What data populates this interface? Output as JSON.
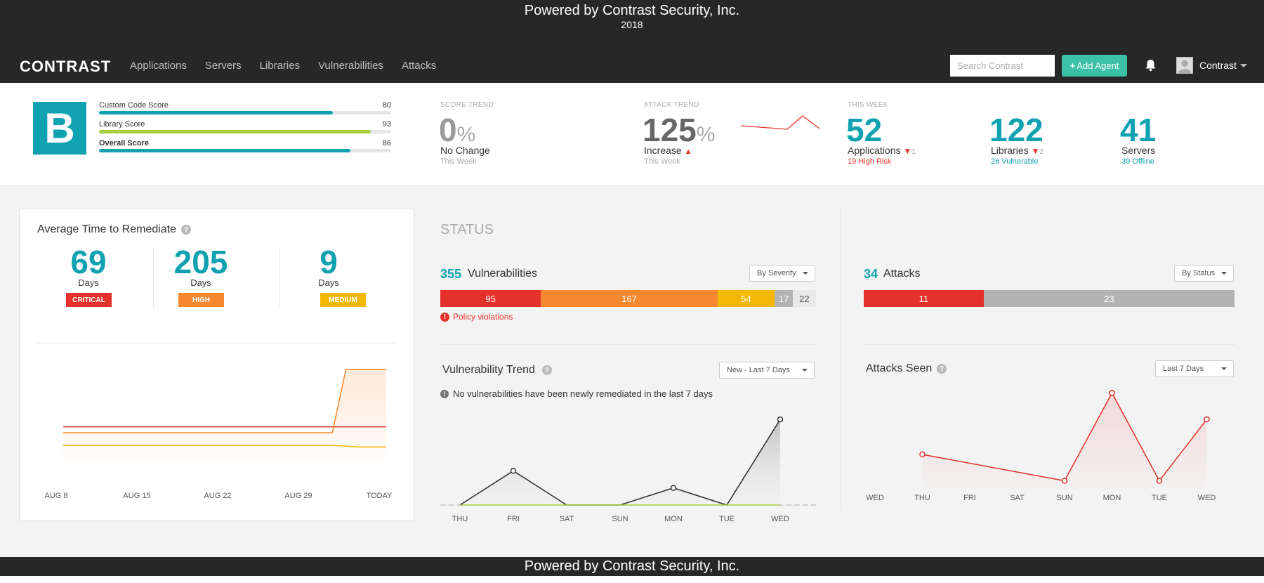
{
  "banner": {
    "title": "Powered by Contrast Security, Inc.",
    "year": "2018"
  },
  "logo": "CONTRAST",
  "nav": [
    "Applications",
    "Servers",
    "Libraries",
    "Vulnerabilities",
    "Attacks"
  ],
  "search": {
    "placeholder": "Search Contrast",
    "value": ""
  },
  "add_agent_label": "Add Agent",
  "user": {
    "name": "Contrast"
  },
  "colors": {
    "teal": "#11a2b1",
    "green": "#3cc0a8",
    "critical": "#e4322b",
    "high": "#f7882f",
    "medium": "#f5b800",
    "lime": "#a5cd3e",
    "grey": "#b3b3b3"
  },
  "scores": {
    "grade": "B",
    "items": [
      {
        "label": "Custom Code Score",
        "value": 80
      },
      {
        "label": "Library Score",
        "value": 93
      },
      {
        "label": "Overall Score",
        "value": 86
      }
    ]
  },
  "score_trend": {
    "caption": "SCORE TREND",
    "value": "0",
    "unit": "%",
    "status": "No Change",
    "period": "This Week"
  },
  "attack_trend": {
    "caption": "ATTACK TREND",
    "value": "125",
    "unit": "%",
    "status": "Increase",
    "period": "This Week"
  },
  "this_week": {
    "caption": "THIS WEEK",
    "applications": {
      "value": "52",
      "label": "Applications",
      "delta": "1",
      "sub": "19 High Risk"
    },
    "libraries": {
      "value": "122",
      "label": "Libraries",
      "delta": "2",
      "sub": "26 Vulnerable"
    },
    "servers": {
      "value": "41",
      "label": "Servers",
      "sub": "39 Offline"
    }
  },
  "remediate": {
    "title": "Average Time to Remediate",
    "items": [
      {
        "value": "69",
        "unit": "Days",
        "severity": "CRITICAL"
      },
      {
        "value": "205",
        "unit": "Days",
        "severity": "HIGH"
      },
      {
        "value": "9",
        "unit": "Days",
        "severity": "MEDIUM"
      }
    ]
  },
  "status": {
    "title": "STATUS",
    "vulnerabilities": {
      "count": "355",
      "label": "Vulnerabilities",
      "dropdown": "By Severity",
      "segments": [
        {
          "value": "95",
          "color": "#e4322b"
        },
        {
          "value": "167",
          "color": "#f7882f"
        },
        {
          "value": "54",
          "color": "#f5b800"
        },
        {
          "value": "17",
          "color": "#b3b3b3"
        },
        {
          "value": "22",
          "color": "#e9e9e9"
        }
      ],
      "policy": "Policy violations"
    },
    "attacks": {
      "count": "34",
      "label": "Attacks",
      "dropdown": "By Status",
      "segments": [
        {
          "value": "11",
          "color": "#e4322b"
        },
        {
          "value": "23",
          "color": "#b3b3b3"
        }
      ]
    }
  },
  "vuln_trend": {
    "title": "Vulnerability Trend",
    "dropdown": "New - Last 7 Days",
    "message": "No vulnerabilities have been newly remediated in the last 7 days"
  },
  "attacks_seen": {
    "title": "Attacks Seen",
    "dropdown": "Last 7 Days"
  },
  "chart_data": [
    {
      "type": "line",
      "title": "Average Time to Remediate",
      "x": [
        "AUG 8",
        "AUG 15",
        "AUG 22",
        "AUG 29",
        "TODAY"
      ],
      "series": [
        {
          "values": [
            0.84,
            0.84,
            0.84,
            0.84,
            0.84,
            0.84,
            0.84,
            0.84,
            0.84,
            0.84,
            0.84,
            0.84,
            0.84,
            0.84,
            0.84,
            0.84,
            0.84,
            0.84,
            0.84,
            0.84,
            0.84,
            0.84,
            0.84,
            0.84,
            0.84
          ],
          "color": "#e4322b"
        },
        {
          "values": [
            0.7,
            0.7,
            0.7,
            0.7,
            0.7,
            0.7,
            0.7,
            0.7,
            0.7,
            0.7,
            0.7,
            0.7,
            0.7,
            0.7,
            0.7,
            0.7,
            0.7,
            0.7,
            0.7,
            0.7,
            0.7,
            2.2,
            2.2,
            2.2,
            2.2
          ],
          "color": "#f7882f"
        },
        {
          "values": [
            0.4,
            0.4,
            0.4,
            0.4,
            0.4,
            0.4,
            0.4,
            0.4,
            0.4,
            0.4,
            0.4,
            0.4,
            0.4,
            0.4,
            0.4,
            0.4,
            0.4,
            0.4,
            0.4,
            0.4,
            0.4,
            0.38,
            0.36,
            0.36,
            0.36
          ],
          "color": "#f5b800"
        }
      ],
      "ylim": [
        0,
        2.5
      ]
    },
    {
      "type": "area",
      "title": "Vulnerability Trend",
      "x": [
        "THU",
        "FRI",
        "SAT",
        "SUN",
        "MON",
        "TUE",
        "WED"
      ],
      "series": [
        {
          "values": [
            0,
            2,
            0,
            0,
            1,
            0,
            5
          ],
          "color": "#333333"
        },
        {
          "values": [
            0,
            0,
            0,
            0,
            0,
            0,
            0
          ],
          "color": "#a5cd3e"
        }
      ],
      "ylim": [
        0,
        5.5
      ]
    },
    {
      "type": "line",
      "title": "Attacks Seen",
      "x": [
        "WED",
        "THU",
        "FRI",
        "SAT",
        "SUN",
        "MON",
        "TUE",
        "WED"
      ],
      "series": [
        {
          "values": [
            null,
            4,
            null,
            null,
            1,
            11,
            1,
            8
          ],
          "color": "#e4322b"
        }
      ],
      "ylim": [
        0,
        12
      ]
    }
  ]
}
